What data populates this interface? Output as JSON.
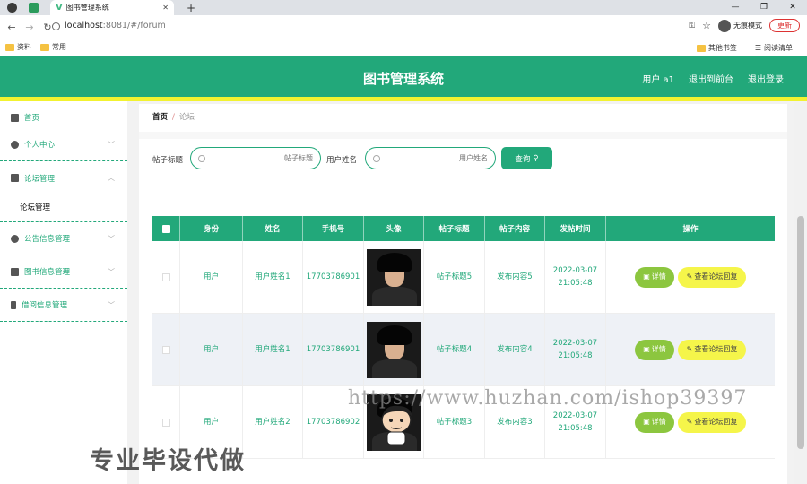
{
  "browser": {
    "tab_title": "图书管理系统",
    "url_host": "localhost",
    "url_rest": ":8081/#/forum",
    "incognito_label": "无痕模式",
    "update_label": "更新",
    "bookmarks": [
      "资料",
      "常用"
    ],
    "bookmarks_right": [
      "其他书签",
      "阅读清单"
    ]
  },
  "header": {
    "title": "图书管理系统",
    "user": "用户 a1",
    "back_label": "退出到前台",
    "logout_label": "退出登录"
  },
  "sidebar": {
    "items": [
      {
        "label": "首页",
        "icon": "home-icon"
      },
      {
        "label": "个人中心",
        "icon": "user-icon"
      },
      {
        "label": "论坛管理",
        "icon": "clipboard-icon"
      },
      {
        "label": "论坛管理",
        "icon": ""
      },
      {
        "label": "公告信息管理",
        "icon": "gauge-icon"
      },
      {
        "label": "图书信息管理",
        "icon": "monitor-icon"
      },
      {
        "label": "借阅信息管理",
        "icon": "phone-icon"
      }
    ]
  },
  "breadcrumb": {
    "home": "首页",
    "sep": "/",
    "current": "论坛"
  },
  "search": {
    "title_label": "帖子标题",
    "title_placeholder": "帖子标题",
    "name_label": "用户姓名",
    "name_placeholder": "用户姓名",
    "query_label": "查询"
  },
  "table": {
    "headers": [
      "身份",
      "姓名",
      "手机号",
      "头像",
      "帖子标题",
      "帖子内容",
      "发帖时间",
      "操作"
    ],
    "rows": [
      {
        "role": "用户",
        "name": "用户姓名1",
        "phone": "17703786901",
        "title": "帖子标题5",
        "content": "发布内容5",
        "time": "2022-03-07 21:05:48"
      },
      {
        "role": "用户",
        "name": "用户姓名1",
        "phone": "17703786901",
        "title": "帖子标题4",
        "content": "发布内容4",
        "time": "2022-03-07 21:05:48"
      },
      {
        "role": "用户",
        "name": "用户姓名2",
        "phone": "17703786902",
        "title": "帖子标题3",
        "content": "发布内容3",
        "time": "2022-03-07 21:05:48"
      }
    ],
    "detail_label": "详情",
    "reply_label": "查看论坛回复"
  },
  "watermark": {
    "url": "https://www.huzhan.com/ishop39397",
    "caption": "专业毕设代做"
  }
}
